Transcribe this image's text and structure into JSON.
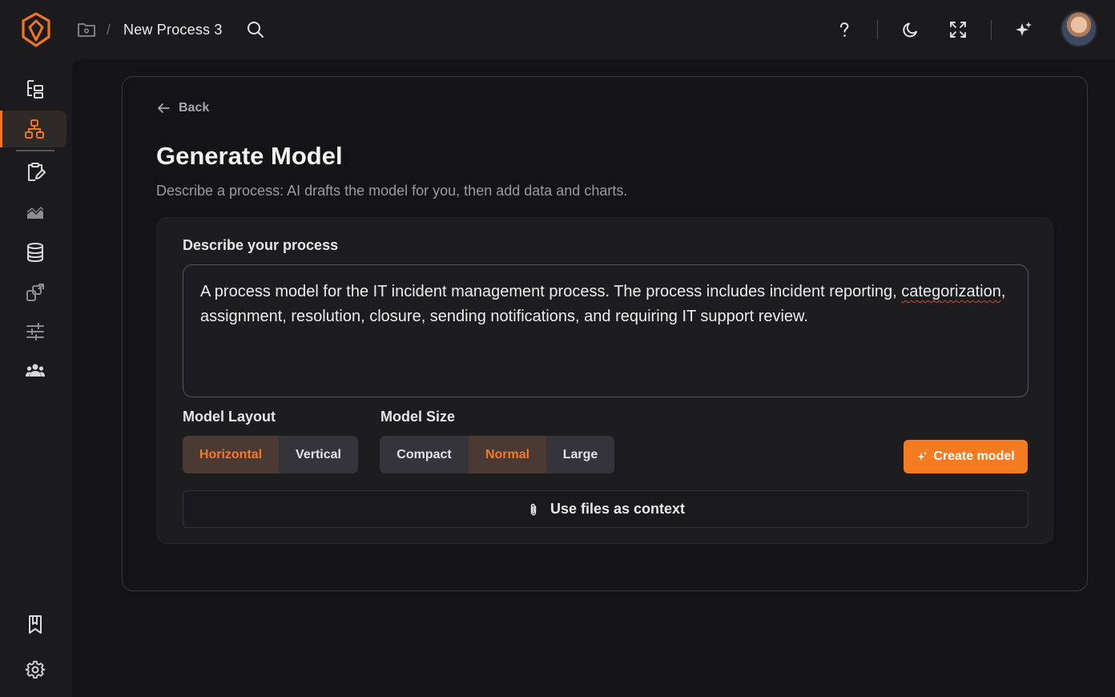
{
  "header": {
    "breadcrumb_separator": "/",
    "process_title": "New Process 3",
    "icons": [
      "logo-icon",
      "folder-icon",
      "search-icon",
      "help-icon",
      "moon-icon",
      "fullscreen-icon",
      "sparkle-icon",
      "avatar"
    ]
  },
  "sidebar": {
    "items": [
      {
        "icon": "tree-icon",
        "active": false
      },
      {
        "icon": "process-model-icon",
        "active": true
      },
      {
        "icon": "clipboard-edit-icon",
        "active": false
      },
      {
        "icon": "chart-area-icon",
        "active": false
      },
      {
        "icon": "database-icon",
        "active": false
      },
      {
        "icon": "export-icon",
        "active": false
      },
      {
        "icon": "sliders-icon",
        "active": false
      },
      {
        "icon": "users-icon",
        "active": false
      },
      {
        "icon": "bookmark-icon",
        "active": false
      },
      {
        "icon": "gear-icon",
        "active": false
      }
    ]
  },
  "main": {
    "back_label": "Back",
    "title": "Generate Model",
    "subtitle": "Describe a process: AI drafts the model for you, then add data and charts.",
    "describe_label": "Describe your process",
    "description_before": "A process model for the IT incident management process. The process includes incident reporting, ",
    "description_misspelled": "categorization",
    "description_after": ", assignment, resolution, closure, sending notifications, and requiring IT support review.",
    "layout": {
      "label": "Model Layout",
      "options": [
        "Horizontal",
        "Vertical"
      ],
      "selected": "Horizontal"
    },
    "size": {
      "label": "Model Size",
      "options": [
        "Compact",
        "Normal",
        "Large"
      ],
      "selected": "Normal"
    },
    "create_button": "Create model",
    "files_button": "Use files as context"
  },
  "colors": {
    "accent": "#f47b20",
    "background": "#141416",
    "panel": "#1d1d20"
  }
}
